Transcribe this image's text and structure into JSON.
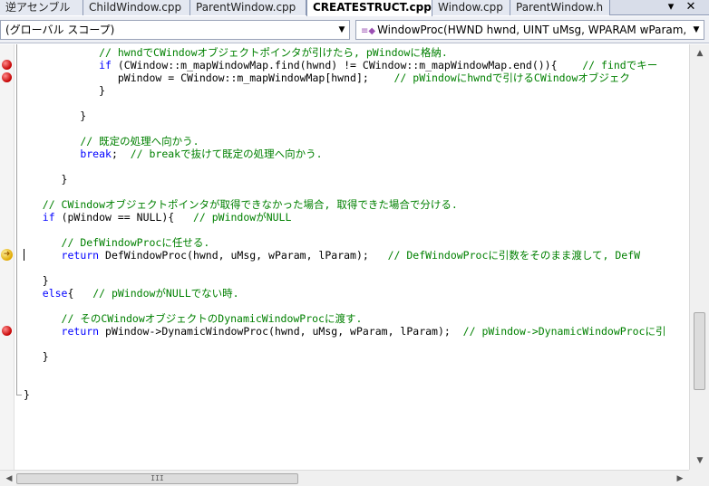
{
  "tabs": [
    {
      "label": "逆アセンブル",
      "active": false
    },
    {
      "label": "ChildWindow.cpp",
      "active": false
    },
    {
      "label": "ParentWindow.cpp",
      "active": false
    },
    {
      "label": "CREATESTRUCT.cpp",
      "active": true
    },
    {
      "label": "Window.cpp",
      "active": false
    },
    {
      "label": "ParentWindow.h",
      "active": false
    }
  ],
  "tab_controls": {
    "dropdown_icon": "▾",
    "close_icon": "✕"
  },
  "navbar": {
    "scope_combo": "(グローバル スコープ)",
    "member_combo": "WindowProc(HWND hwnd, UINT uMsg, WPARAM wParam,",
    "member_icon": "function-icon"
  },
  "code_lines": [
    [
      {
        "t": "            "
      },
      {
        "t": "// hwndでCWindowオブジェクトポインタが引けたら, pWindowに格納.",
        "c": "cm"
      }
    ],
    [
      {
        "t": "            "
      },
      {
        "t": "if",
        "c": "kw"
      },
      {
        "t": " (CWindow::m_mapWindowMap.find(hwnd) != CWindow::m_mapWindowMap.end()){    "
      },
      {
        "t": "// findでキー",
        "c": "cm"
      }
    ],
    [
      {
        "t": "               pWindow = CWindow::m_mapWindowMap[hwnd];    "
      },
      {
        "t": "// pWindowにhwndで引けるCWindowオブジェク",
        "c": "cm"
      }
    ],
    [
      {
        "t": "            }"
      }
    ],
    [
      {
        "t": ""
      }
    ],
    [
      {
        "t": "         }"
      }
    ],
    [
      {
        "t": ""
      }
    ],
    [
      {
        "t": "         "
      },
      {
        "t": "// 既定の処理へ向かう.",
        "c": "cm"
      }
    ],
    [
      {
        "t": "         "
      },
      {
        "t": "break",
        "c": "kw"
      },
      {
        "t": ";  "
      },
      {
        "t": "// breakで抜けて既定の処理へ向かう.",
        "c": "cm"
      }
    ],
    [
      {
        "t": ""
      }
    ],
    [
      {
        "t": "      }"
      }
    ],
    [
      {
        "t": ""
      }
    ],
    [
      {
        "t": "   "
      },
      {
        "t": "// CWindowオブジェクトポインタが取得できなかった場合, 取得できた場合で分ける.",
        "c": "cm"
      }
    ],
    [
      {
        "t": "   "
      },
      {
        "t": "if",
        "c": "kw"
      },
      {
        "t": " (pWindow == NULL){   "
      },
      {
        "t": "// pWindowがNULL",
        "c": "cm"
      }
    ],
    [
      {
        "t": ""
      }
    ],
    [
      {
        "t": "      "
      },
      {
        "t": "// DefWindowProcに任せる.",
        "c": "cm"
      }
    ],
    [
      {
        "t": "      "
      },
      {
        "t": "return",
        "c": "kw"
      },
      {
        "t": " DefWindowProc(hwnd, uMsg, wParam, lParam);   "
      },
      {
        "t": "// DefWindowProcに引数をそのまま渡して, DefW",
        "c": "cm"
      }
    ],
    [
      {
        "t": ""
      }
    ],
    [
      {
        "t": "   }"
      }
    ],
    [
      {
        "t": "   "
      },
      {
        "t": "else",
        "c": "kw"
      },
      {
        "t": "{   "
      },
      {
        "t": "// pWindowがNULLでない時.",
        "c": "cm"
      }
    ],
    [
      {
        "t": ""
      }
    ],
    [
      {
        "t": "      "
      },
      {
        "t": "// そのCWindowオブジェクトのDynamicWindowProcに渡す.",
        "c": "cm"
      }
    ],
    [
      {
        "t": "      "
      },
      {
        "t": "return",
        "c": "kw"
      },
      {
        "t": " pWindow->DynamicWindowProc(hwnd, uMsg, wParam, lParam);  "
      },
      {
        "t": "// pWindow->DynamicWindowProcに引",
        "c": "cm"
      }
    ],
    [
      {
        "t": ""
      }
    ],
    [
      {
        "t": "   }"
      }
    ],
    [
      {
        "t": ""
      }
    ],
    [
      {
        "t": ""
      }
    ],
    [
      {
        "t": "}"
      }
    ]
  ],
  "breakpoint_lines": [
    1,
    2,
    22
  ],
  "current_line": 16,
  "markers": {
    "breakpoint_icon": "breakpoint-icon",
    "current_statement_icon": "current-statement-arrow-icon"
  },
  "scrollbars": {
    "up": "▲",
    "down": "▼",
    "left": "◀",
    "right": "▶",
    "grip": "III"
  },
  "colors": {
    "keyword": "#0000ff",
    "comment": "#008000",
    "text": "#000000",
    "breakpoint": "#c40000",
    "current_statement": "#e0a800"
  }
}
